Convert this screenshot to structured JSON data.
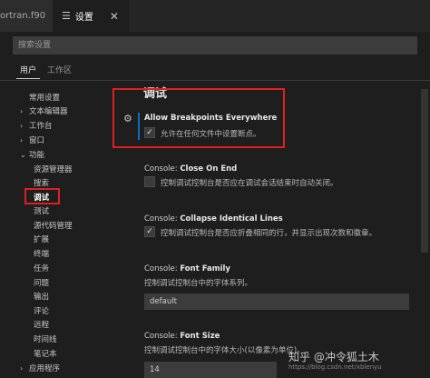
{
  "tabs": {
    "fortran": "ortran.f90",
    "settings": "设置",
    "settings_icon": "settings-lines-icon",
    "close": "✕"
  },
  "search": {
    "placeholder": "搜索设置"
  },
  "scopes": {
    "user": "用户",
    "workspace": "工作区"
  },
  "toc": {
    "items": [
      {
        "label": "常用设置",
        "chevron": ""
      },
      {
        "label": "文本编辑器",
        "chevron": "›"
      },
      {
        "label": "工作台",
        "chevron": "›"
      },
      {
        "label": "窗口",
        "chevron": "›"
      },
      {
        "label": "功能",
        "chevron": "⌄"
      },
      {
        "label": "资源管理器",
        "chevron": ""
      },
      {
        "label": "搜索",
        "chevron": ""
      },
      {
        "label": "调试",
        "chevron": ""
      },
      {
        "label": "测试",
        "chevron": ""
      },
      {
        "label": "源代码管理",
        "chevron": ""
      },
      {
        "label": "扩展",
        "chevron": ""
      },
      {
        "label": "终端",
        "chevron": ""
      },
      {
        "label": "任务",
        "chevron": ""
      },
      {
        "label": "问题",
        "chevron": ""
      },
      {
        "label": "输出",
        "chevron": ""
      },
      {
        "label": "评论",
        "chevron": ""
      },
      {
        "label": "远程",
        "chevron": ""
      },
      {
        "label": "时间线",
        "chevron": ""
      },
      {
        "label": "笔记本",
        "chevron": ""
      },
      {
        "label": "应用程序",
        "chevron": "›"
      }
    ]
  },
  "content": {
    "heading": "调试",
    "settings": [
      {
        "prefix": "",
        "name": "Allow Breakpoints Everywhere",
        "desc": "允许在任何文件中设置断点。",
        "checked": "✓"
      },
      {
        "prefix": "Console: ",
        "name": "Close On End",
        "desc": "控制调试控制台是否应在调试会话结束时自动关闭。",
        "checked": ""
      },
      {
        "prefix": "Console: ",
        "name": "Collapse Identical Lines",
        "desc": "控制调试控制台是否应折叠相同的行，并显示出现次数和徽章。",
        "checked": "✓"
      },
      {
        "prefix": "Console: ",
        "name": "Font Family",
        "desc": "控制调试控制台中的字体系列。",
        "value": "default"
      },
      {
        "prefix": "Console: ",
        "name": "Font Size",
        "desc": "控制调试控制台中的字体大小(以像素为单位)。",
        "value": "14"
      }
    ]
  },
  "watermark": {
    "text": "知乎 @冲令狐土木",
    "url": "https://blog.csdn.net/xblenyu"
  },
  "colors": {
    "accent": "#0e70c0",
    "highlight": "#e02020",
    "background": "#1e1e1e"
  }
}
